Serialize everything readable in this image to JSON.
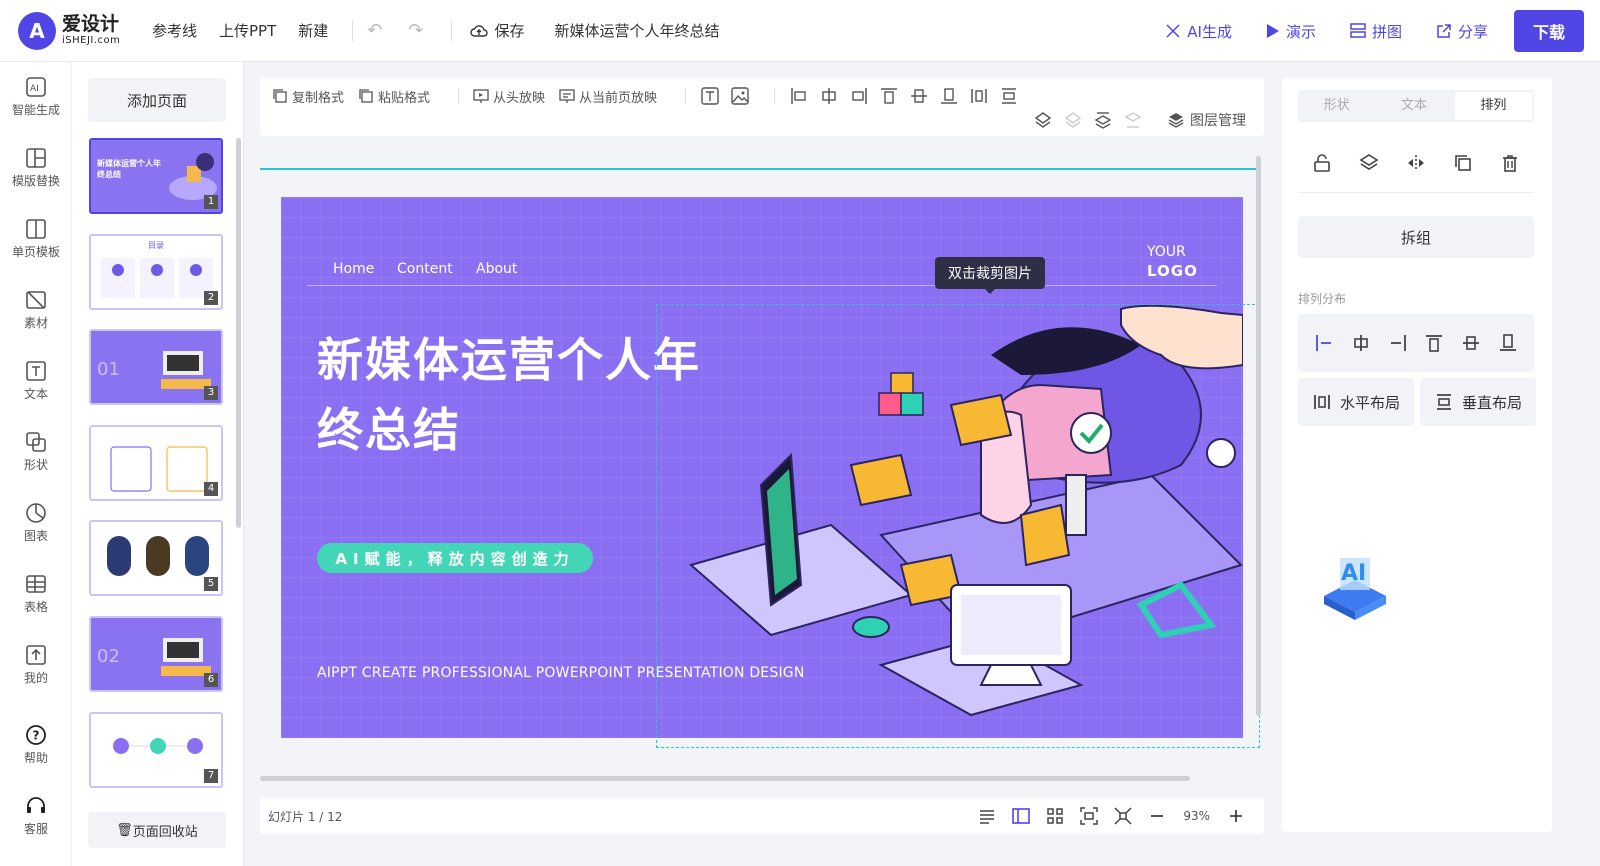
{
  "app": {
    "logo_cn": "爱设计",
    "logo_en": "iSHEJI.com",
    "logo_mark": "A",
    "doc_title": "新媒体运营个人年终总结"
  },
  "topnav": [
    "参考线",
    "上传PPT",
    "新建"
  ],
  "top_actions": {
    "save": "保存",
    "ai_generate": "AI生成",
    "present": "演示",
    "collage": "拼图",
    "share": "分享",
    "download": "下载"
  },
  "rail": [
    "智能生成",
    "模版替换",
    "单页模板",
    "素材",
    "文本",
    "形状",
    "图表",
    "表格",
    "我的",
    "帮助",
    "客服"
  ],
  "pages": {
    "add_page": "添加页面",
    "recycle": "页面回收站",
    "thumbs": [
      {
        "num": "1",
        "label": "新媒体运营个人年终总结"
      },
      {
        "num": "2",
        "label": "目录"
      },
      {
        "num": "3",
        "label": "01"
      },
      {
        "num": "4",
        "label": ""
      },
      {
        "num": "5",
        "label": ""
      },
      {
        "num": "6",
        "label": "02"
      },
      {
        "num": "7",
        "label": ""
      }
    ]
  },
  "toolbar": {
    "copy_format": "复制格式",
    "paste_format": "粘贴格式",
    "play_from_start": "从头放映",
    "play_from_current": "从当前页放映",
    "layer_manage": "图层管理"
  },
  "slide": {
    "nav": [
      "Home",
      "Content",
      "About"
    ],
    "logo_line1": "YOUR",
    "logo_line2": "LOGO",
    "title_line1": "新媒体运营个人年",
    "title_line2": "终总结",
    "pill": "AI赋能，释放内容创造力",
    "subtitle": "AIPPT CREATE PROFESSIONAL POWERPOINT  PRESENTATION DESIGN",
    "tooltip": "双击裁剪图片"
  },
  "status": {
    "slide_counter": "幻灯片 1 / 12",
    "zoom": "93%"
  },
  "rpanel": {
    "tabs": [
      "形状",
      "文本",
      "排列"
    ],
    "ungroup": "拆组",
    "arrange_label": "排列分布",
    "h_distribute": "水平布局",
    "v_distribute": "垂直布局",
    "ai_badge": "AI"
  },
  "colors": {
    "accent": "#4f46e5",
    "slide_bg": "#8b6ff3",
    "pill": "#43d6b6",
    "guide": "#2ec5d3"
  }
}
